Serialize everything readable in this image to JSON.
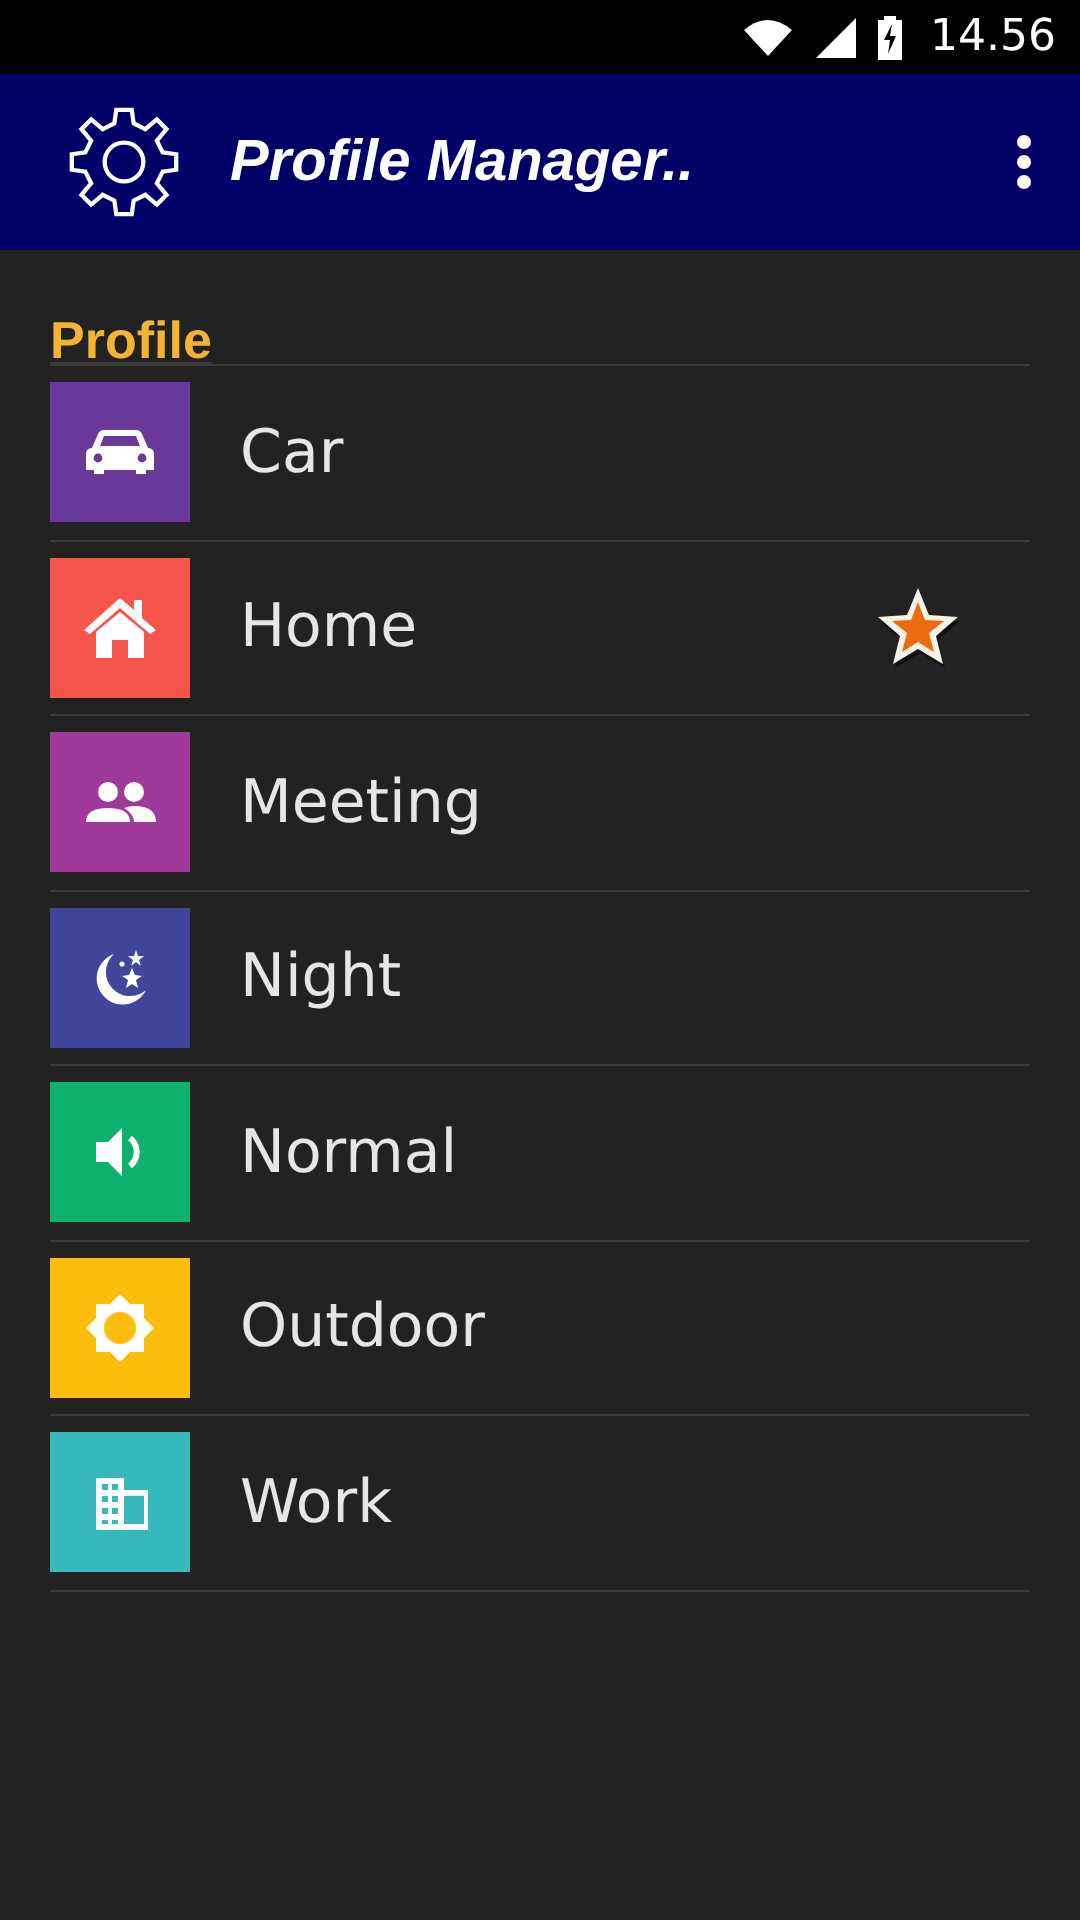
{
  "status_bar": {
    "time": "14.56"
  },
  "app_bar": {
    "title": "Profile Manager.."
  },
  "section": {
    "title": "Profile"
  },
  "profiles": [
    {
      "name": "Car",
      "kind": "car",
      "color": "#6a3a9a",
      "active": false
    },
    {
      "name": "Home",
      "kind": "home",
      "color": "#f5554a",
      "active": true
    },
    {
      "name": "Meeting",
      "kind": "people",
      "color": "#a03a9a",
      "active": false
    },
    {
      "name": "Night",
      "kind": "night",
      "color": "#42459a",
      "active": false
    },
    {
      "name": "Normal",
      "kind": "sound",
      "color": "#0db06c",
      "active": false
    },
    {
      "name": "Outdoor",
      "kind": "sun",
      "color": "#fdbd0d",
      "active": false
    },
    {
      "name": "Work",
      "kind": "building",
      "color": "#36b9bb",
      "active": false
    }
  ]
}
